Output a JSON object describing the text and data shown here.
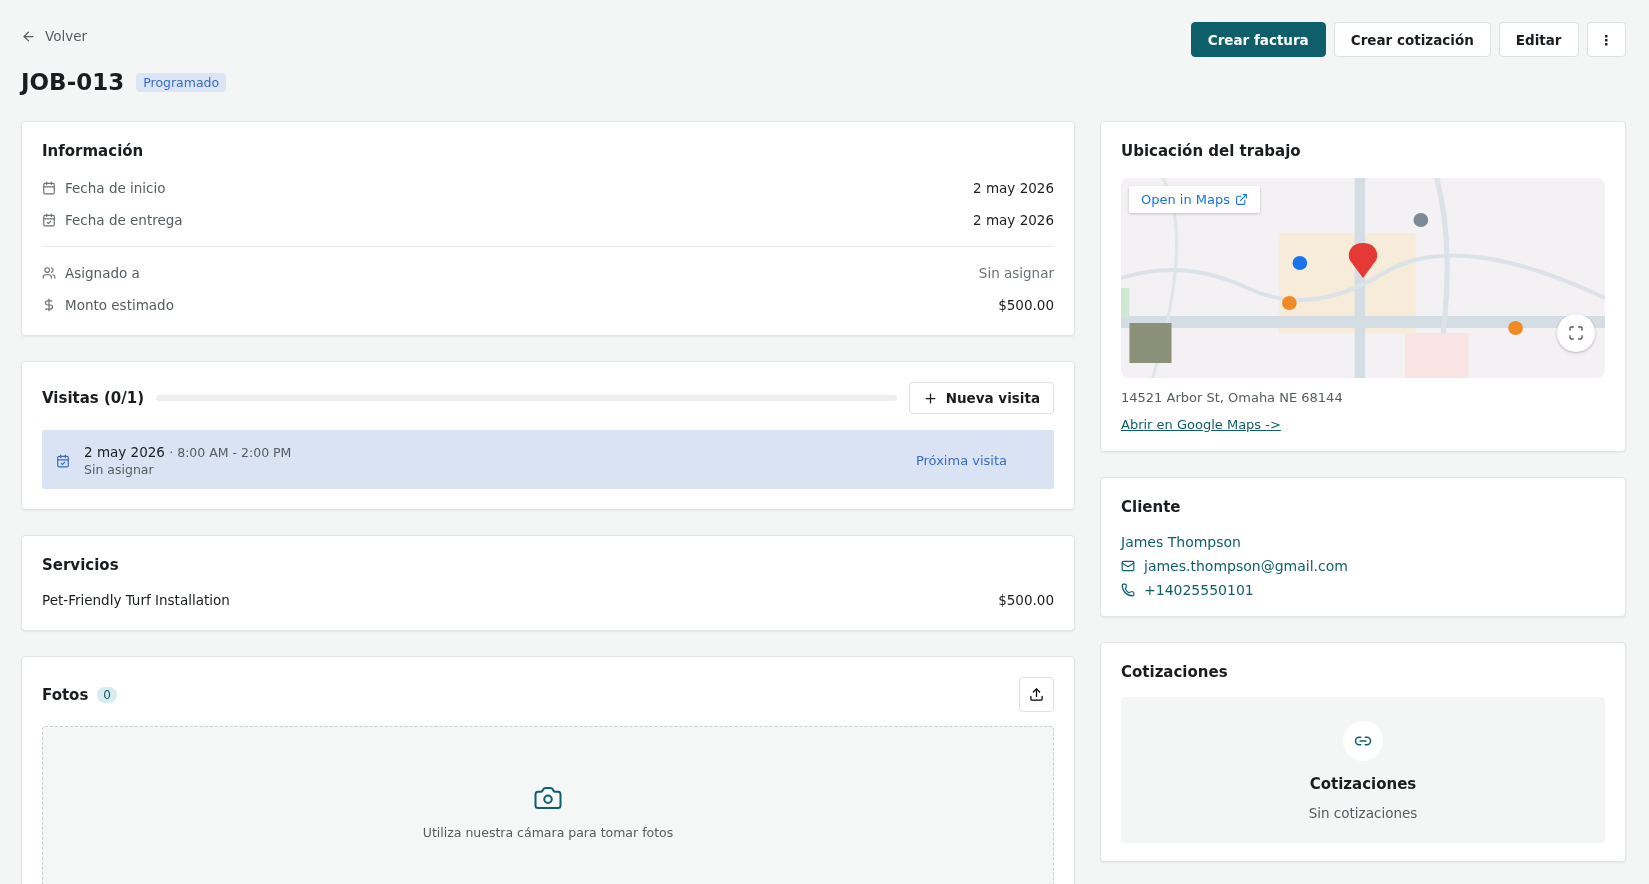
{
  "back_link": "Volver",
  "header": {
    "title": "JOB-013",
    "status": "Programado"
  },
  "actions": [
    {
      "label": "Crear factura",
      "kind": "primary"
    },
    {
      "label": "Crear cotización",
      "kind": "secondary"
    },
    {
      "label": "Editar",
      "kind": "secondary"
    },
    {
      "label": "⋮",
      "kind": "more"
    }
  ],
  "info": {
    "title": "Información",
    "groups": [
      [
        {
          "label": "Fecha de inicio",
          "value": "2 may 2026",
          "muted": false
        },
        {
          "label": "Fecha de entrega",
          "value": "2 may 2026",
          "muted": false
        }
      ],
      [
        {
          "label": "Asignado a",
          "value": "Sin asignar",
          "muted": true
        },
        {
          "label": "Monto estimado",
          "value": "$500.00",
          "muted": false
        }
      ]
    ]
  },
  "visits": {
    "title": "Visitas (0/1)",
    "level": 0,
    "button": "Nueva visita",
    "items": [
      {
        "date": "2 may 2026",
        "time": "· 8:00 AM - 2:00 PM",
        "assignee": "Sin asignar",
        "tag": "Próxima visita"
      }
    ]
  },
  "services": {
    "title": "Servicios",
    "items": [
      {
        "name": "Pet-Friendly Turf Installation",
        "price": "$500.00"
      }
    ]
  },
  "photos": {
    "title": "Fotos",
    "count": "0",
    "empty_text": "Utiliza nuestra cámara para tomar fotos"
  },
  "location": {
    "title": "Ubicación del trabajo",
    "map": {
      "kind": "picture",
      "open_button": "Open in Maps"
    },
    "address": "14521 Arbor St, Omaha NE 68144",
    "link": "Abrir en Google Maps ->"
  },
  "client": {
    "title": "Cliente",
    "name": "James Thompson",
    "email": "james.thompson@gmail.com",
    "phone": "+14025550101"
  },
  "quotes": {
    "title": "Cotizaciones",
    "empty_title": "Cotizaciones",
    "empty_text": "Sin cotizaciones"
  }
}
